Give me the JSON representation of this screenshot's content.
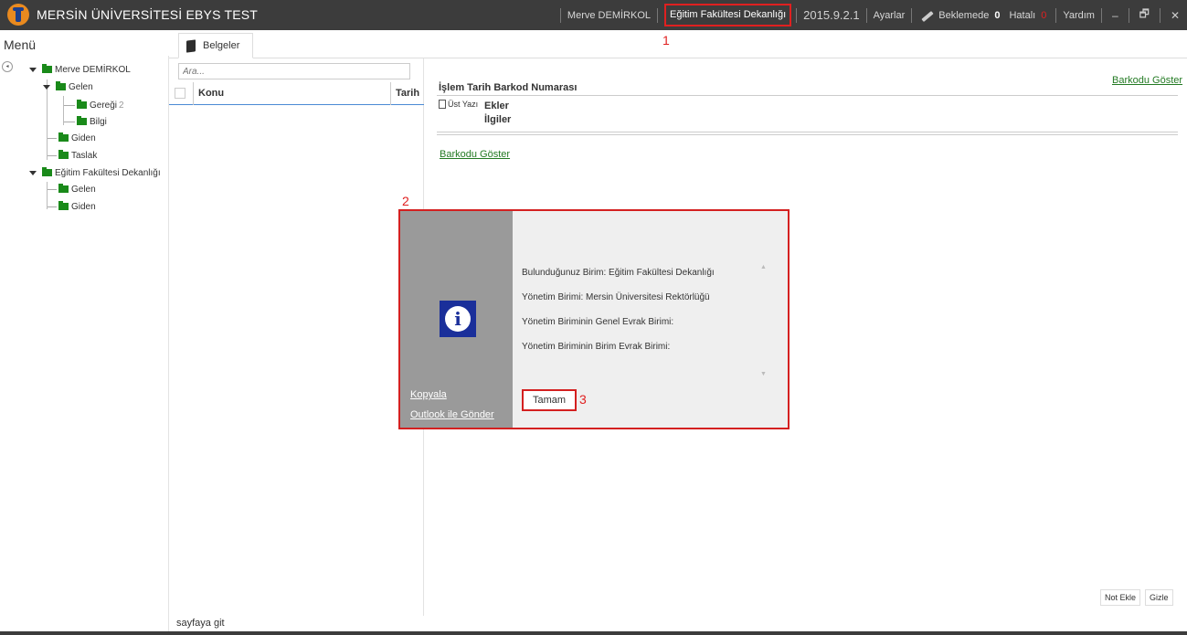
{
  "app": {
    "title": "MERSİN ÜNİVERSİTESİ EBYS TEST"
  },
  "titlebar": {
    "user": "Merve DEMİRKOL",
    "unit": "Eğitim Fakültesi Dekanlığı",
    "version": "2015.9.2.1",
    "settings": "Ayarlar",
    "pending_label": "Beklemede",
    "pending_count": "0",
    "error_label": "Hatalı",
    "error_count": "0",
    "help": "Yardım",
    "minimize": "‒",
    "restore": "🗗",
    "close": "✕"
  },
  "markers": {
    "m1": "1",
    "m2": "2",
    "m3": "3"
  },
  "menu": {
    "header": "Menü",
    "collapse": "◂",
    "tree": {
      "user_root": "Merve DEMİRKOL",
      "gelen": "Gelen",
      "geregi": "Gereği",
      "geregi_count": "2",
      "bilgi": "Bilgi",
      "giden": "Giden",
      "taslak": "Taslak",
      "unit_root": "Eğitim Fakültesi Dekanlığı",
      "unit_gelen": "Gelen",
      "unit_giden": "Giden"
    }
  },
  "tabs": {
    "belgeler": "Belgeler"
  },
  "list": {
    "search_placeholder": "Ara...",
    "col_konu": "Konu",
    "col_tarih": "Tarih",
    "page_link": "sayfaya git"
  },
  "detail": {
    "title": "İşlem Tarih Barkod Numarası",
    "barcode_link": "Barkodu Göster",
    "ust_yazi": "Üst Yazı",
    "ekler": "Ekler",
    "ilgiler": "İlgiler",
    "note_button": "Not Ekle",
    "hide_button": "Gizle"
  },
  "dialog": {
    "lines": [
      "Bulunduğunuz Birim: Eğitim Fakültesi Dekanlığı",
      "Yönetim Birimi: Mersin Üniversitesi Rektörlüğü",
      "Yönetim Biriminin Genel Evrak Birimi:",
      "Yönetim Biriminin Birim Evrak Birimi:"
    ],
    "copy_link": "Kopyala",
    "outlook_link": "Outlook ile Gönder",
    "ok_button": "Tamam",
    "info_glyph": "i",
    "scroll_up": "▲",
    "scroll_down": "▼"
  },
  "colors": {
    "titlebar_bg": "#3c3c3c",
    "highlight_red": "#e02020",
    "folder_green": "#1a8a1a",
    "link_green": "#237a23",
    "info_blue": "#1a2f9a"
  }
}
